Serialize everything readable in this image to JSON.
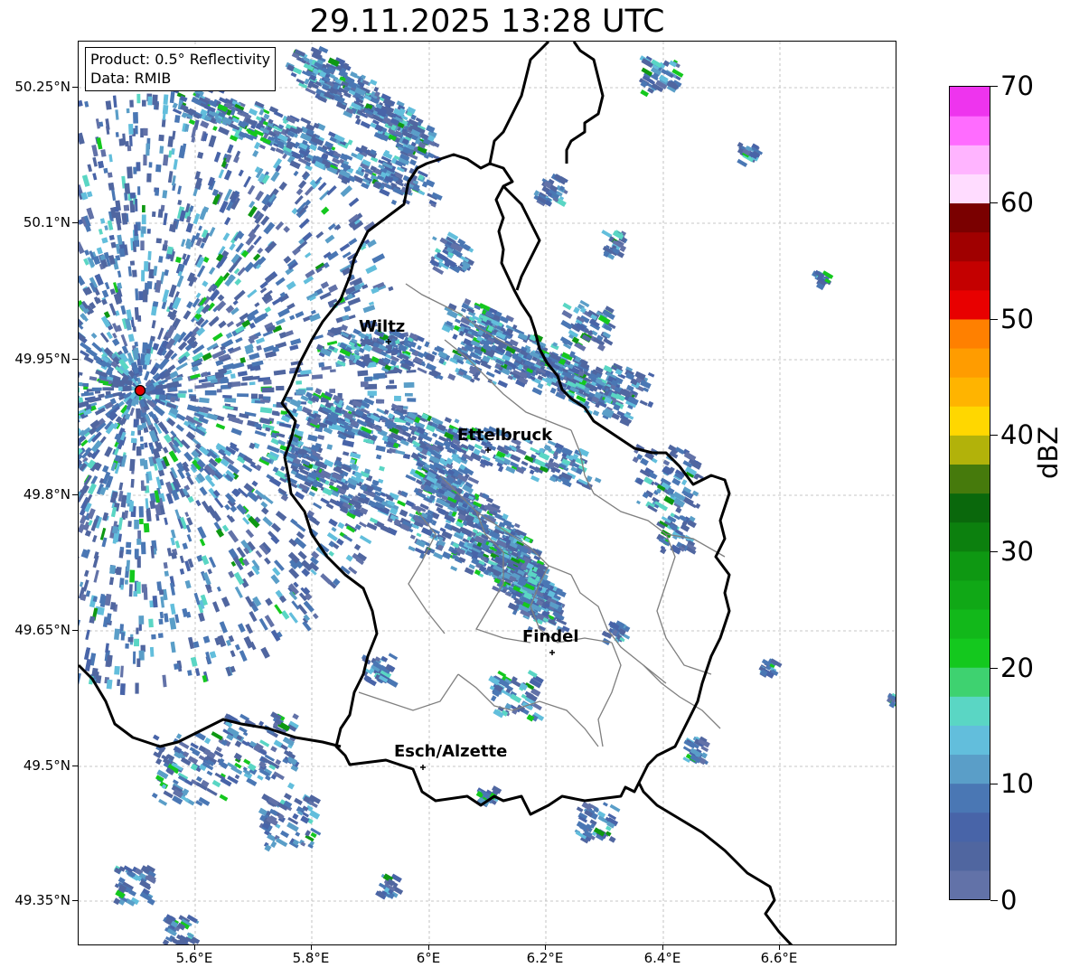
{
  "title": "29.11.2025 13:28 UTC",
  "info": {
    "product": "Product: 0.5° Reflectivity",
    "data": "Data: RMIB"
  },
  "axes": {
    "lat_labels": [
      "50.25°N",
      "50.1°N",
      "49.95°N",
      "49.8°N",
      "49.65°N",
      "49.5°N",
      "49.35°N"
    ],
    "lon_labels": [
      "5.6°E",
      "5.8°E",
      "6°E",
      "6.2°E",
      "6.4°E",
      "6.6°E"
    ]
  },
  "cities": [
    "Wiltz",
    "Ettelbruck",
    "Findel",
    "Esch/Alzette"
  ],
  "colorbar": {
    "unit": "dBZ",
    "ticks": [
      "0",
      "10",
      "20",
      "30",
      "40",
      "50",
      "60",
      "70"
    ],
    "colors": [
      "#6272a8",
      "#5066a0",
      "#4864a8",
      "#4a77b4",
      "#5a9ec8",
      "#62bedc",
      "#5ad6c4",
      "#3ed270",
      "#14c81e",
      "#12b81a",
      "#10a816",
      "#0e9812",
      "#0c800e",
      "#0a680c",
      "#467a0c",
      "#b2b20a",
      "#ffd700",
      "#ffb400",
      "#ff9c00",
      "#ff8000",
      "#e80000",
      "#c40000",
      "#a00000",
      "#7a0000",
      "#ffdcff",
      "#ffb4ff",
      "#ff6cff",
      "#ee34ee"
    ]
  },
  "colors": {
    "border": "#000000",
    "canton_lines": "#7f7f7f",
    "radar_site": "#e00000"
  }
}
